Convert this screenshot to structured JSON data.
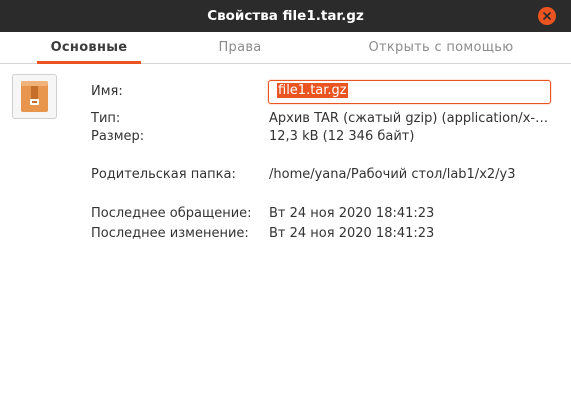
{
  "window": {
    "title": "Свойства file1.tar.gz",
    "accent_color": "#e95420",
    "close_icon": "close-icon"
  },
  "tabs": [
    {
      "label": "Основные",
      "active": true
    },
    {
      "label": "Права",
      "active": false
    },
    {
      "label": "Открыть с помощью",
      "active": false
    }
  ],
  "file": {
    "icon": "archive-icon",
    "name_label": "Имя:",
    "name_value": "file1.tar.gz",
    "type_label": "Тип:",
    "type_value": "Архив TAR (сжатый gzip) (application/x-…",
    "size_label": "Размер:",
    "size_value": "12,3 kB (12 346 байт)",
    "parent_label": "Родительская папка:",
    "parent_value": "/home/yana/Рабочий стол/lab1/x2/y3",
    "accessed_label": "Последнее обращение:",
    "accessed_value": "Вт 24 ноя 2020 18:41:23",
    "modified_label": "Последнее изменение:",
    "modified_value": "Вт 24 ноя 2020 18:41:23"
  }
}
